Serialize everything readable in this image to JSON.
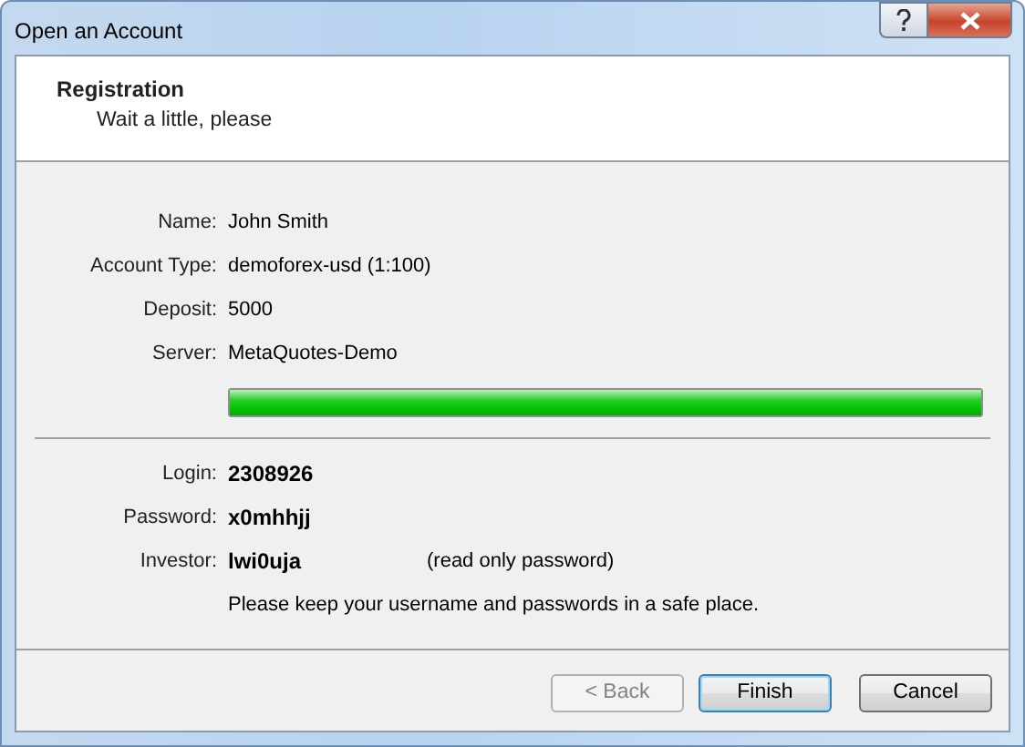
{
  "window": {
    "title": "Open an Account"
  },
  "header": {
    "title": "Registration",
    "subtitle": "Wait a little, please"
  },
  "details": [
    {
      "label": "Name:",
      "value": "John Smith"
    },
    {
      "label": "Account Type:",
      "value": "demoforex-usd (1:100)"
    },
    {
      "label": "Deposit:",
      "value": "5000"
    },
    {
      "label": "Server:",
      "value": "MetaQuotes-Demo"
    }
  ],
  "progress": {
    "level": 1
  },
  "credentials": [
    {
      "label": "Login:",
      "value": "2308926"
    },
    {
      "label": "Password:",
      "value": "x0mhhjj"
    },
    {
      "label": "Investor:",
      "value": "lwi0uja",
      "note": "(read only password)"
    }
  ],
  "notice": "Please keep your username and passwords in a safe place.",
  "buttons": [
    {
      "label": "< Back",
      "disabled": true,
      "default": false
    },
    {
      "label": "Finish",
      "disabled": false,
      "default": true
    },
    {
      "label": "Cancel",
      "disabled": false,
      "default": false
    }
  ]
}
